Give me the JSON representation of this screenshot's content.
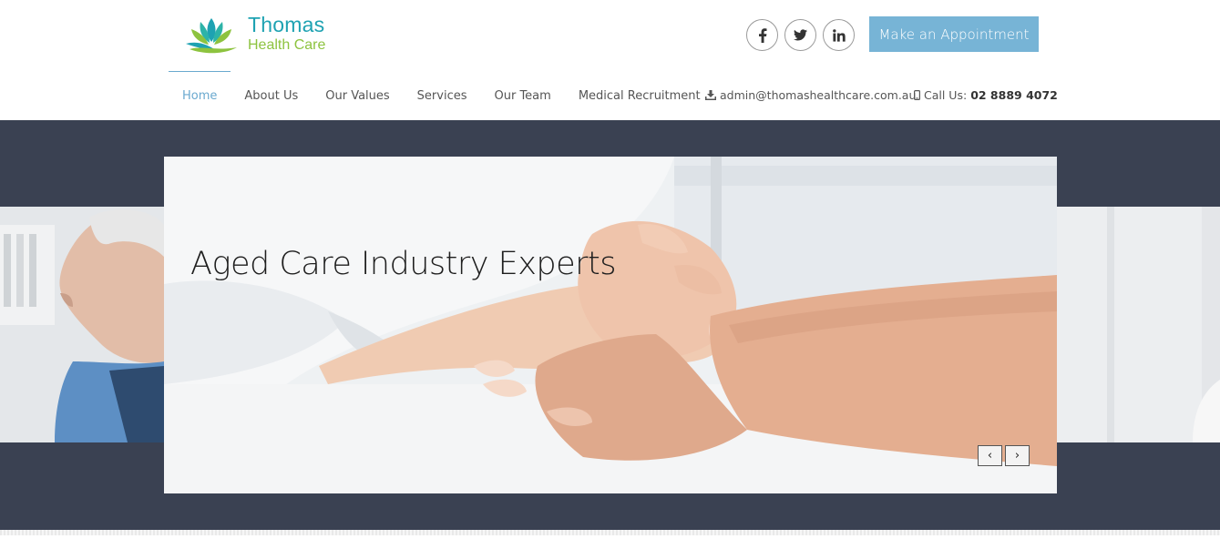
{
  "logo": {
    "name": "Thomas",
    "subtitle": "Health Care",
    "colors": {
      "teal": "#1ea2b2",
      "green": "#8dc33f"
    }
  },
  "social": [
    {
      "icon": "facebook-icon"
    },
    {
      "icon": "twitter-icon"
    },
    {
      "icon": "linkedin-icon"
    }
  ],
  "header": {
    "cta_label": "Make an Appointment",
    "cta_color": "#77b4d6"
  },
  "nav": {
    "items": [
      {
        "label": "Home",
        "active": true
      },
      {
        "label": "About Us",
        "active": false
      },
      {
        "label": "Our Values",
        "active": false
      },
      {
        "label": "Services",
        "active": false
      },
      {
        "label": "Our Team",
        "active": false
      },
      {
        "label": "Medical Recruitment",
        "active": false
      }
    ],
    "active_color": "#6aa9cf"
  },
  "contact": {
    "email": "admin@thomashealthcare.com.au",
    "email_icon": "download-icon",
    "phone_prefix": "Call Us:",
    "phone": "02 8889 4072",
    "phone_icon": "mobile-phone-icon"
  },
  "hero": {
    "title": "Aged Care Industry Experts",
    "prev_label": "‹",
    "next_label": "›",
    "background_color": "#3a4152"
  }
}
